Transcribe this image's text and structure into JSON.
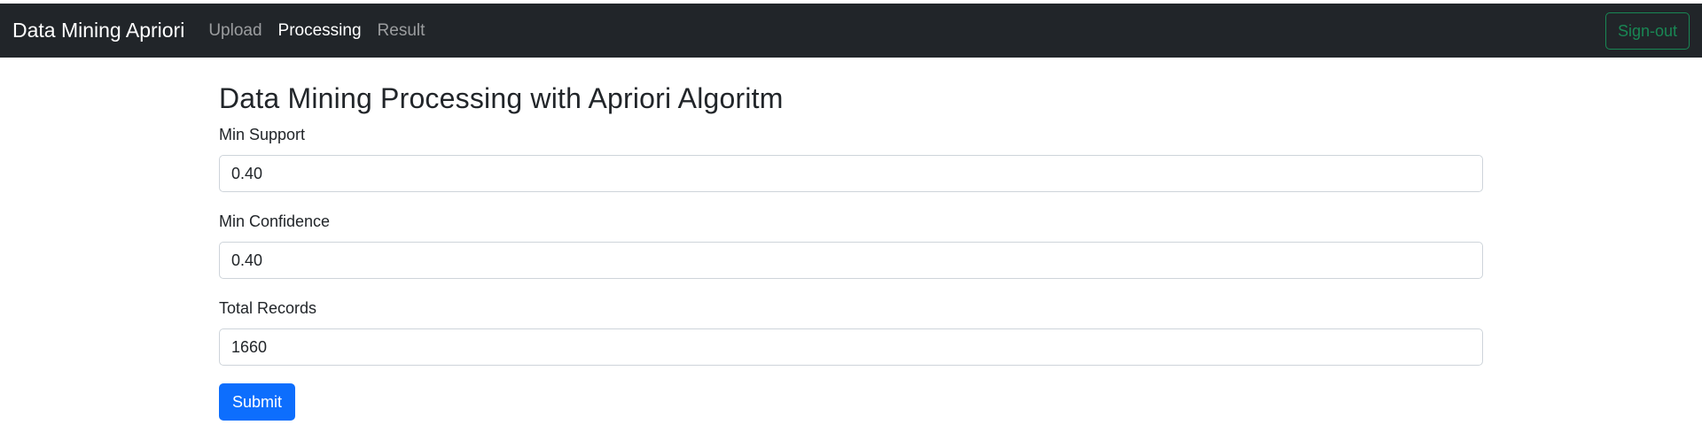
{
  "navbar": {
    "brand": "Data Mining Apriori",
    "links": [
      {
        "label": "Upload",
        "active": false
      },
      {
        "label": "Processing",
        "active": true
      },
      {
        "label": "Result",
        "active": false
      }
    ],
    "signout_label": "Sign-out",
    "background": "#212529",
    "signout_color": "#198754"
  },
  "main": {
    "title": "Data Mining Processing with Apriori Algoritm",
    "fields": {
      "min_support": {
        "label": "Min Support",
        "value": "0.40"
      },
      "min_confidence": {
        "label": "Min Confidence",
        "value": "0.40"
      },
      "total_records": {
        "label": "Total Records",
        "value": "1660"
      }
    },
    "submit_label": "Submit",
    "submit_color": "#0d6efd"
  }
}
